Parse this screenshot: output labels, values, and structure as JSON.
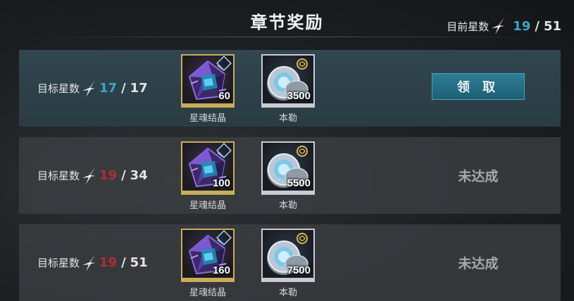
{
  "header": {
    "title": "章节奖励",
    "total_label": "目前星数",
    "total_current": "19",
    "total_separator": "/",
    "total_max": "51"
  },
  "colors": {
    "accent_blue": "#3fa3c8",
    "warning_red": "#b32d35",
    "button": "#1d5f74"
  },
  "rows": [
    {
      "target_label": "目标星数",
      "current": "17",
      "separator": "/",
      "max": "17",
      "state": "done",
      "items": [
        {
          "icon": "star-soul-crystal-icon",
          "qty": "60",
          "name": "星魂结晶"
        },
        {
          "icon": "benle-coin-icon",
          "qty": "3500",
          "name": "本勒"
        }
      ],
      "action_label": "领 取"
    },
    {
      "target_label": "目标星数",
      "current": "19",
      "separator": "/",
      "max": "34",
      "state": "notyet",
      "items": [
        {
          "icon": "star-soul-crystal-icon",
          "qty": "100",
          "name": "星魂结晶"
        },
        {
          "icon": "benle-coin-icon",
          "qty": "5500",
          "name": "本勒"
        }
      ],
      "status_label": "未达成"
    },
    {
      "target_label": "目标星数",
      "current": "19",
      "separator": "/",
      "max": "51",
      "state": "notyet",
      "items": [
        {
          "icon": "star-soul-crystal-icon",
          "qty": "160",
          "name": "星魂结晶"
        },
        {
          "icon": "benle-coin-icon",
          "qty": "7500",
          "name": "本勒"
        }
      ],
      "status_label": "未达成"
    }
  ]
}
